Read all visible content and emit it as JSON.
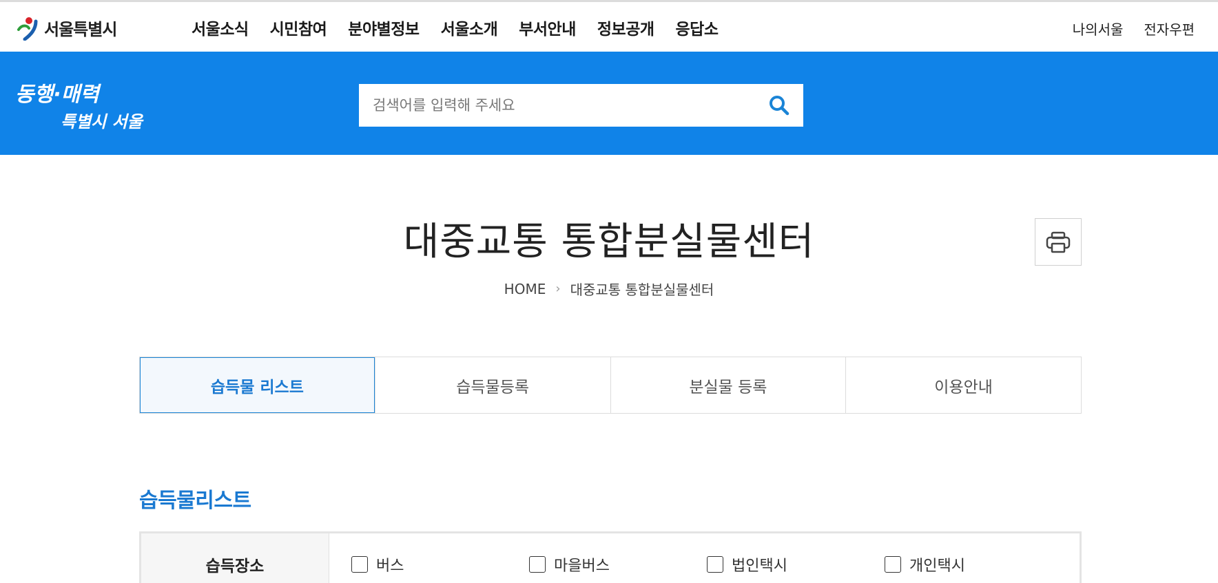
{
  "header": {
    "logo_text": "서울특별시",
    "nav_items": [
      "서울소식",
      "시민참여",
      "분야별정보",
      "서울소개",
      "부서안내",
      "정보공개",
      "응답소"
    ],
    "util_items": [
      "나의서울",
      "전자우편"
    ]
  },
  "band": {
    "slogan_line1": "동행·매력",
    "slogan_line2": "특별시 서울",
    "search_placeholder": "검색어를 입력해 주세요"
  },
  "page": {
    "title": "대중교통 통합분실물센터",
    "breadcrumb": [
      "HOME",
      "대중교통 통합분실물센터"
    ]
  },
  "tabs": [
    {
      "label": "습득물 리스트",
      "active": true
    },
    {
      "label": "습득물등록",
      "active": false
    },
    {
      "label": "분실물 등록",
      "active": false
    },
    {
      "label": "이용안내",
      "active": false
    }
  ],
  "section": {
    "title": "습득물리스트",
    "filter_label": "습득장소",
    "options": [
      "버스",
      "마을버스",
      "법인택시",
      "개인택시"
    ]
  },
  "colors": {
    "brand_blue": "#1083e8",
    "accent_blue": "#1a79d1"
  }
}
